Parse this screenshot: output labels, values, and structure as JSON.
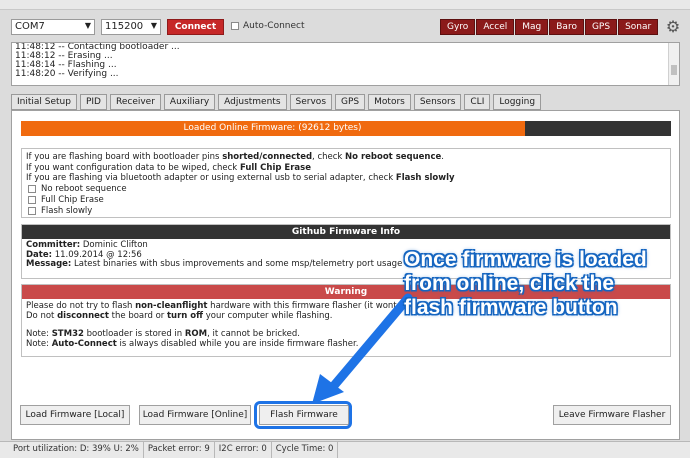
{
  "toolbar": {
    "port": "COM7",
    "baud": "115200",
    "connect_label": "Connect",
    "autoconnect_label": "Auto-Connect",
    "sensors": [
      "Gyro",
      "Accel",
      "Mag",
      "Baro",
      "GPS",
      "Sonar"
    ],
    "settings_icon": "gear-icon"
  },
  "log": [
    "11:48:12 -- Contacting bootloader ...",
    "11:48:12 -- Erasing ...",
    "11:48:14 -- Flashing ...",
    "11:48:20 -- Verifying ..."
  ],
  "tabs": [
    "Initial Setup",
    "PID",
    "Receiver",
    "Auxiliary",
    "Adjustments",
    "Servos",
    "GPS",
    "Motors",
    "Sensors",
    "CLI",
    "Logging"
  ],
  "progress": {
    "label": "Loaded Online Firmware: (92612 bytes)",
    "fraction": 0.775,
    "fill_color": "#f06a0f"
  },
  "info": {
    "line1_a": "If you are flashing board with bootloader pins ",
    "line1_b": "shorted/connected",
    "line1_c": ", check ",
    "line1_d": "No reboot sequence",
    "line1_e": ".",
    "line2_a": "If you want configuration data to be wiped, check ",
    "line2_b": "Full Chip Erase",
    "line3_a": "If you are flashing via bluetooth adapter or using external usb to serial adapter, check ",
    "line3_b": "Flash slowly",
    "options": [
      "No reboot sequence",
      "Full Chip Erase",
      "Flash slowly"
    ]
  },
  "github": {
    "header": "Github Firmware Info",
    "committer_label": "Committer:",
    "committer": " Dominic Clifton",
    "date_label": "Date:",
    "date": " 11.09.2014 @ 12:56",
    "message_label": "Message:",
    "message": " Latest binaries with sbus improvements and some msp/telemetry port usage fixes."
  },
  "warning": {
    "header": "Warning",
    "l1_a": "Please do not try to flash ",
    "l1_b": "non-cleanflight",
    "l1_c": " hardware with this firmware flasher (it wont work).",
    "l2_a": "Do not ",
    "l2_b": "disconnect",
    "l2_c": " the board or ",
    "l2_d": "turn off",
    "l2_e": " your computer while flashing.",
    "l3_a": "Note: ",
    "l3_b": "STM32",
    "l3_c": " bootloader is stored in ",
    "l3_d": "ROM",
    "l3_e": ", it cannot be bricked.",
    "l4_a": "Note: ",
    "l4_b": "Auto-Connect",
    "l4_c": " is always disabled while you are inside firmware flasher."
  },
  "buttons": {
    "load_local": "Load Firmware [Local]",
    "load_online": "Load Firmware [Online]",
    "flash": "Flash Firmware",
    "leave": "Leave Firmware Flasher"
  },
  "annotation": {
    "line1": "Once firmware is loaded",
    "line2": "from online, click the",
    "line3": "flash firmware button",
    "color": "#1e73e6"
  },
  "status": {
    "port_util": "Port utilization: D: 39% U: 2%",
    "packet_error": "Packet error: 9",
    "i2c_error": "I2C error: 0",
    "cycle_time": "Cycle Time: 0"
  }
}
